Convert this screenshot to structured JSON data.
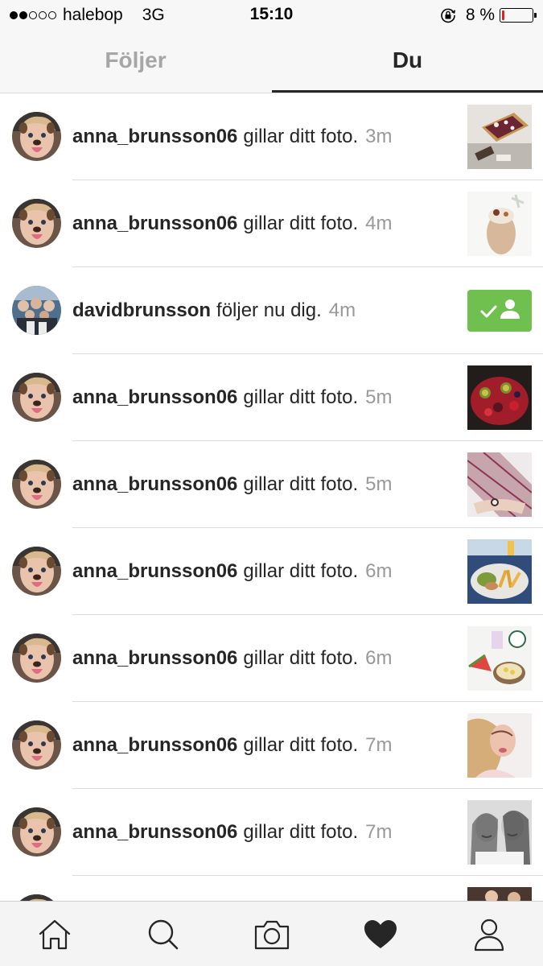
{
  "status_bar": {
    "signal_filled": 2,
    "signal_total": 5,
    "carrier": "halebop",
    "network": "3G",
    "time": "15:10",
    "battery_text": "8 %",
    "battery_level": 0.08,
    "battery_color": "#e0211c"
  },
  "tabs": [
    {
      "label": "Följer",
      "active": false
    },
    {
      "label": "Du",
      "active": true
    }
  ],
  "activity": [
    {
      "username": "anna_brunsson06",
      "action": "gillar ditt foto.",
      "time": "3m",
      "avatar": "anna",
      "thumb": "dessert"
    },
    {
      "username": "anna_brunsson06",
      "action": "gillar ditt foto.",
      "time": "4m",
      "avatar": "anna",
      "thumb": "wrap"
    },
    {
      "username": "davidbrunsson",
      "action": "följer nu dig.",
      "time": "4m",
      "avatar": "group",
      "follow_button": true
    },
    {
      "username": "anna_brunsson06",
      "action": "gillar ditt foto.",
      "time": "5m",
      "avatar": "anna",
      "thumb": "berries"
    },
    {
      "username": "anna_brunsson06",
      "action": "gillar ditt foto.",
      "time": "5m",
      "avatar": "anna",
      "thumb": "wrist"
    },
    {
      "username": "anna_brunsson06",
      "action": "gillar ditt foto.",
      "time": "6m",
      "avatar": "anna",
      "thumb": "food-plate"
    },
    {
      "username": "anna_brunsson06",
      "action": "gillar ditt foto.",
      "time": "6m",
      "avatar": "anna",
      "thumb": "melon-drinks"
    },
    {
      "username": "anna_brunsson06",
      "action": "gillar ditt foto.",
      "time": "7m",
      "avatar": "anna",
      "thumb": "selfie"
    },
    {
      "username": "anna_brunsson06",
      "action": "gillar ditt foto.",
      "time": "7m",
      "avatar": "anna",
      "thumb": "bw-portrait"
    },
    {
      "username": "",
      "action": "",
      "time": "",
      "avatar": "anna",
      "thumb": "partial"
    }
  ],
  "colors": {
    "follow_button": "#70c050",
    "timestamp": "#999999",
    "active_tab": "#262626",
    "inactive_tab": "#a6a6a6"
  },
  "bottom_nav": [
    {
      "icon": "home-icon"
    },
    {
      "icon": "search-icon"
    },
    {
      "icon": "camera-icon"
    },
    {
      "icon": "heart-icon",
      "active": true
    },
    {
      "icon": "profile-icon"
    }
  ]
}
